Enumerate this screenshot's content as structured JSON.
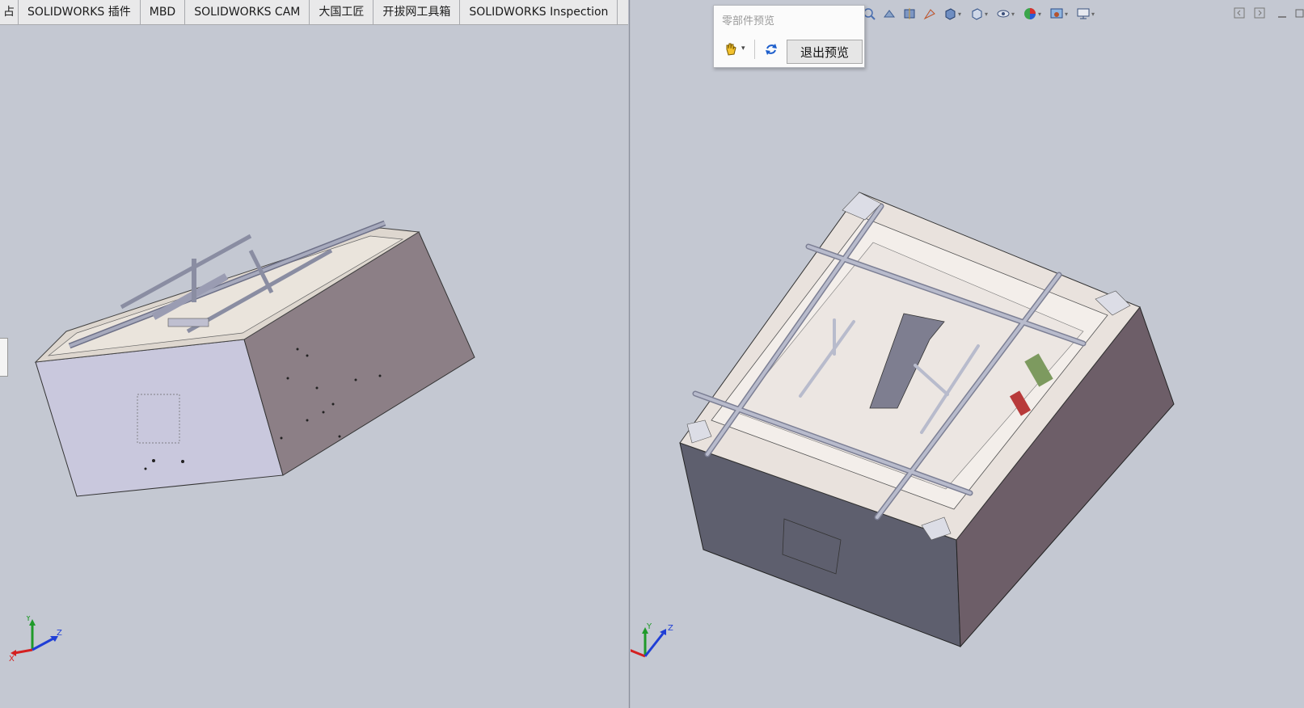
{
  "tabs": [
    {
      "label": "占",
      "cut": true
    },
    {
      "label": "SOLIDWORKS 插件"
    },
    {
      "label": "MBD"
    },
    {
      "label": "SOLIDWORKS CAM"
    },
    {
      "label": "大国工匠"
    },
    {
      "label": "开拔网工具箱"
    },
    {
      "label": "SOLIDWORKS Inspection"
    }
  ],
  "preview_popup": {
    "title": "零部件预览",
    "exit_label": "退出预览"
  },
  "toolbar_icons": [
    "zoom-area-icon",
    "previous-view-icon",
    "section-view-icon",
    "dynamic-annotation-icon",
    "view-orientation-icon",
    "display-style-icon",
    "hide-show-items-icon",
    "edit-appearance-icon",
    "apply-scene-icon",
    "view-settings-icon"
  ],
  "triad": {
    "x_label": "X",
    "y_label": "Y",
    "z_label": "Z"
  },
  "colors": {
    "viewport_bg": "#c4c8d2",
    "axis_x": "#d42020",
    "axis_y": "#1f9a2a",
    "axis_z": "#1f3ed6"
  }
}
